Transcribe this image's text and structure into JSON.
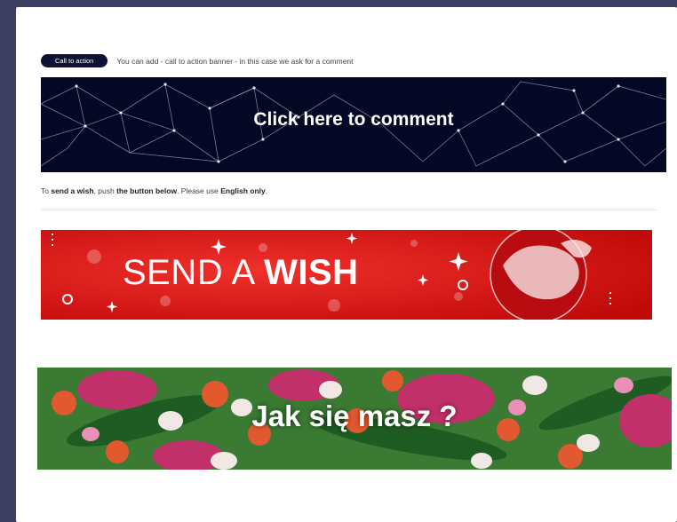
{
  "cta_row": {
    "badge_label": "Call to action",
    "description": "You can add - call to action banner - in this case we ask for a comment"
  },
  "comment_banner": {
    "label": "Click here to comment"
  },
  "instruction": {
    "part1": "To ",
    "bold1": "send a wish",
    "part2": ", push ",
    "bold2": "the button below",
    "part3": ". Please use ",
    "bold3": "English only",
    "part4": "."
  },
  "wish_banner": {
    "label_light": "SEND A ",
    "label_bold": "WISH"
  },
  "greeting_banner": {
    "label": "Jak się masz ?"
  },
  "colors": {
    "frame_background": "#3d3f63",
    "comment_banner_background": "#050825",
    "wish_banner_background": "#de1010",
    "greeting_banner_background": "#3d7c36",
    "badge_background": "#0d1133"
  }
}
